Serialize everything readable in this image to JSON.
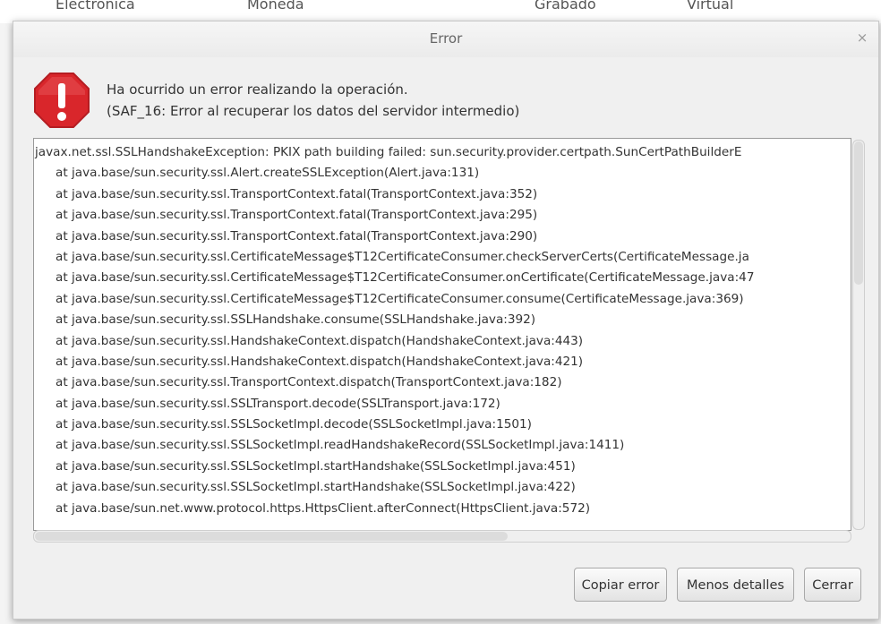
{
  "background_app": {
    "tabs": [
      "Electrónica",
      "Moneda",
      "Grabado",
      "Virtual"
    ]
  },
  "dialog": {
    "title": "Error",
    "close_glyph": "×",
    "message_line1": "Ha ocurrido un error realizando la operación.",
    "message_line2": "(SAF_16: Error al recuperar los datos del servidor intermedio)",
    "stack_trace": [
      "javax.net.ssl.SSLHandshakeException: PKIX path building failed: sun.security.provider.certpath.SunCertPathBuilderE",
      "at java.base/sun.security.ssl.Alert.createSSLException(Alert.java:131)",
      "at java.base/sun.security.ssl.TransportContext.fatal(TransportContext.java:352)",
      "at java.base/sun.security.ssl.TransportContext.fatal(TransportContext.java:295)",
      "at java.base/sun.security.ssl.TransportContext.fatal(TransportContext.java:290)",
      "at java.base/sun.security.ssl.CertificateMessage$T12CertificateConsumer.checkServerCerts(CertificateMessage.ja",
      "at java.base/sun.security.ssl.CertificateMessage$T12CertificateConsumer.onCertificate(CertificateMessage.java:47",
      "at java.base/sun.security.ssl.CertificateMessage$T12CertificateConsumer.consume(CertificateMessage.java:369)",
      "at java.base/sun.security.ssl.SSLHandshake.consume(SSLHandshake.java:392)",
      "at java.base/sun.security.ssl.HandshakeContext.dispatch(HandshakeContext.java:443)",
      "at java.base/sun.security.ssl.HandshakeContext.dispatch(HandshakeContext.java:421)",
      "at java.base/sun.security.ssl.TransportContext.dispatch(TransportContext.java:182)",
      "at java.base/sun.security.ssl.SSLTransport.decode(SSLTransport.java:172)",
      "at java.base/sun.security.ssl.SSLSocketImpl.decode(SSLSocketImpl.java:1501)",
      "at java.base/sun.security.ssl.SSLSocketImpl.readHandshakeRecord(SSLSocketImpl.java:1411)",
      "at java.base/sun.security.ssl.SSLSocketImpl.startHandshake(SSLSocketImpl.java:451)",
      "at java.base/sun.security.ssl.SSLSocketImpl.startHandshake(SSLSocketImpl.java:422)",
      "at java.base/sun.net.www.protocol.https.HttpsClient.afterConnect(HttpsClient.java:572)"
    ],
    "buttons": {
      "copy_label": "Copiar error",
      "less_label": "Menos detalles",
      "close_label": "Cerrar"
    }
  },
  "colors": {
    "error_icon": "#d9262b",
    "dialog_bg": "#f0f0f0",
    "trace_bg": "#ffffff"
  },
  "icons": {
    "error": "error-octagon-icon",
    "close": "close-icon"
  }
}
